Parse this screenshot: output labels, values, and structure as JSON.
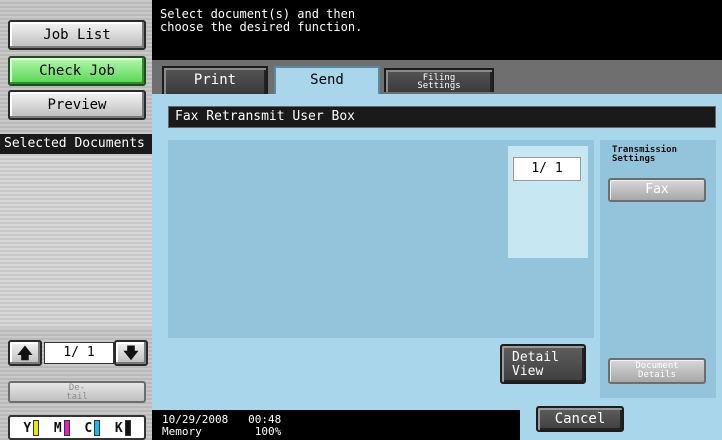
{
  "sidebar": {
    "job_list": "Job List",
    "check_job": "Check Job",
    "preview": "Preview",
    "selected_documents": "Selected Documents",
    "page_indicator": "1/  1",
    "up_arrow": "🡅",
    "down_arrow": "🡇",
    "detail_button": "De-\ntail",
    "toner": [
      {
        "label": "Y",
        "color": "#e8e800"
      },
      {
        "label": "M",
        "color": "#e020c0"
      },
      {
        "label": "C",
        "color": "#20b8e8"
      },
      {
        "label": "K",
        "color": "#111111"
      }
    ]
  },
  "header": {
    "message": "Select document(s) and then\nchoose the desired function."
  },
  "tabs": {
    "print": "Print",
    "send": "Send",
    "filing_settings": "Filing\nSettings"
  },
  "main": {
    "box_title": "Fax Retransmit User Box",
    "doc_page": "1/  1",
    "detail_view": "Detail\nView",
    "transmission_settings": "Transmission\nSettings",
    "fax": "Fax",
    "document_details": "Document\nDetails"
  },
  "status": {
    "datetime": "10/29/2008   00:48",
    "memory": "Memory        100%",
    "cancel": "Cancel"
  }
}
